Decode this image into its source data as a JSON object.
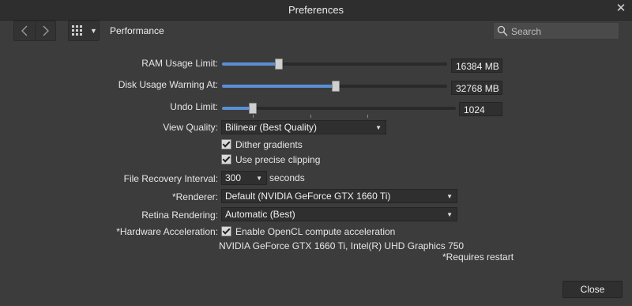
{
  "window": {
    "title": "Preferences"
  },
  "toolbar": {
    "section_title": "Performance",
    "search_placeholder": "Search"
  },
  "ram_usage": {
    "label": "RAM Usage Limit:",
    "value": "16384 MB",
    "level": 0.25
  },
  "disk_warning": {
    "label": "Disk Usage Warning At:",
    "value": "32768 MB",
    "level": 0.5
  },
  "undo_limit": {
    "label": "Undo Limit:",
    "value": "1024",
    "level": 0.13
  },
  "view_quality": {
    "label": "View Quality:",
    "selected": "Bilinear (Best Quality)"
  },
  "dither_gradients": {
    "label": "Dither gradients",
    "checked": true
  },
  "precise_clipping": {
    "label": "Use precise clipping",
    "checked": true
  },
  "file_recovery": {
    "label": "File Recovery Interval:",
    "selected": "300",
    "unit": "seconds"
  },
  "renderer": {
    "label": "*Renderer:",
    "selected": "Default (NVIDIA GeForce GTX 1660 Ti)"
  },
  "retina": {
    "label": "Retina Rendering:",
    "selected": "Automatic (Best)"
  },
  "hardware_accel": {
    "label": "*Hardware Acceleration:",
    "checkbox_label": "Enable OpenCL compute acceleration",
    "checked": true,
    "devices": "NVIDIA GeForce GTX 1660 Ti, Intel(R) UHD Graphics 750"
  },
  "footnote": "*Requires restart",
  "buttons": {
    "close": "Close"
  },
  "colors": {
    "accent": "#5a8fd6",
    "background": "#3c3c3c",
    "titlebar": "#2e2e2e"
  },
  "icons": {
    "back": "chevron-left-icon",
    "forward": "chevron-right-icon",
    "grid": "grid-icon",
    "search": "search-icon",
    "close": "close-icon"
  }
}
